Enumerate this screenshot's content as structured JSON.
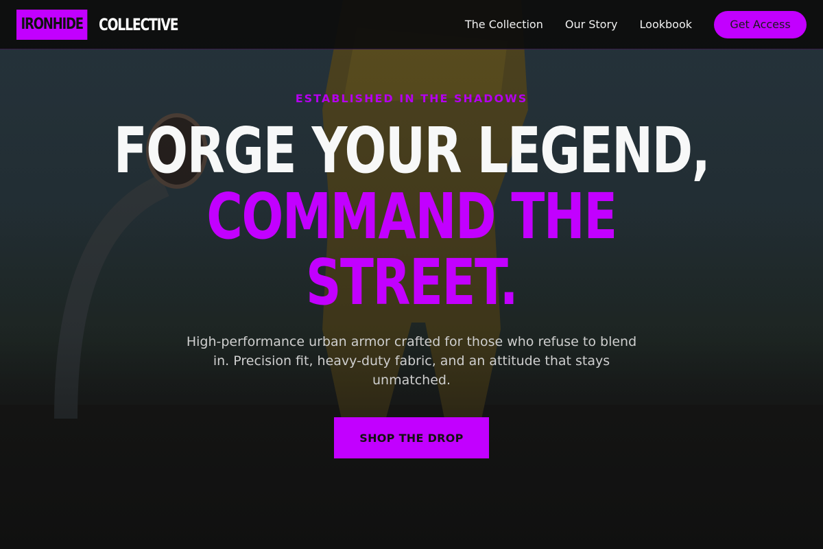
{
  "navbar": {
    "brand_box": "IRONHIDE",
    "brand_text": "COLLECTIVE",
    "links": [
      "The Collection",
      "Our Story",
      "Lookbook"
    ],
    "cta_label": "Get Access"
  },
  "hero": {
    "eyebrow": "ESTABLISHED IN THE SHADOWS",
    "headline_line1": "FORGE YOUR LEGEND,",
    "headline_line2": "COMMAND THE",
    "headline_line3": "STREET.",
    "subtitle": "High-performance urban armor crafted for those who refuse to blend in. Precision fit, heavy-duty fabric, and an attitude that stays unmatched.",
    "button_label": "SHOP THE DROP",
    "background_image": "person-in-yellow-tracksuit-basketball-hoop"
  },
  "colors": {
    "accent": "#c200ff",
    "navbar_bg": "#0c0c0c",
    "text_muted": "#cfcfcf"
  }
}
